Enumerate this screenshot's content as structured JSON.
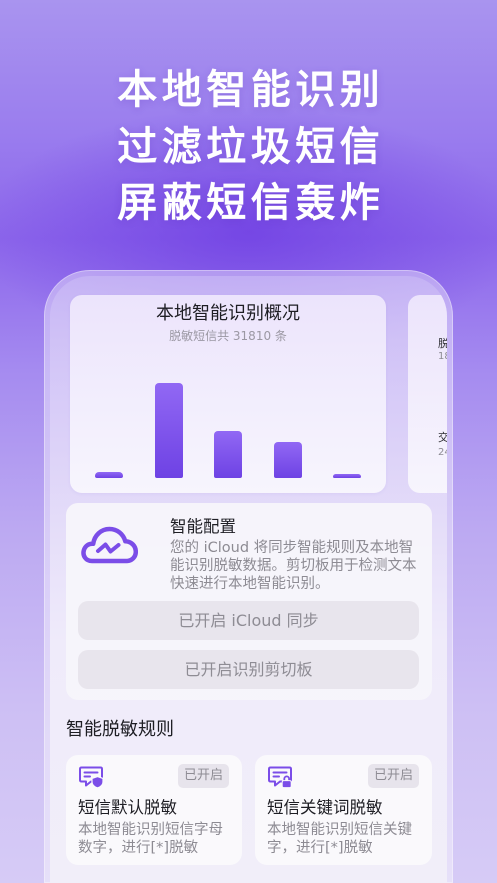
{
  "headline": {
    "lines": [
      "本地智能识别",
      "过滤垃圾短信",
      "屏蔽短信轰炸"
    ]
  },
  "chart_data": {
    "type": "bar",
    "title": "本地智能识别概况",
    "subtitle": "脱敏短信共 31810 条",
    "values": [
      5,
      74,
      37,
      28,
      3
    ],
    "grid": false,
    "bar_colors": [
      "#9168f4",
      "#6e42e4"
    ]
  },
  "side_card": {
    "items": [
      {
        "label": "脱",
        "value": "18"
      },
      {
        "label": "交",
        "value": "24"
      }
    ]
  },
  "config": {
    "icon": "cloud-sync-icon",
    "title": "智能配置",
    "description": "您的 iCloud 将同步智能规则及本地智能识别脱敏数据。剪切板用于检测文本快速进行本地智能识别。",
    "buttons": {
      "icloud_sync": "已开启 iCloud 同步",
      "clipboard": "已开启识别剪切板"
    }
  },
  "rules": {
    "title": "智能脱敏规则",
    "items": [
      {
        "icon": "message-shield-icon",
        "status": "已开启",
        "title": "短信默认脱敏",
        "description": "本地智能识别短信字母数字，进行[*]脱敏"
      },
      {
        "icon": "message-lock-icon",
        "status": "已开启",
        "title": "短信关键词脱敏",
        "description": "本地智能识别短信关键字，进行[*]脱敏"
      }
    ]
  },
  "colors": {
    "accent": "#7b4de8",
    "text_primary": "#1e1e24",
    "text_secondary": "#8d8b93",
    "button_bg": "#e8e5ed"
  }
}
